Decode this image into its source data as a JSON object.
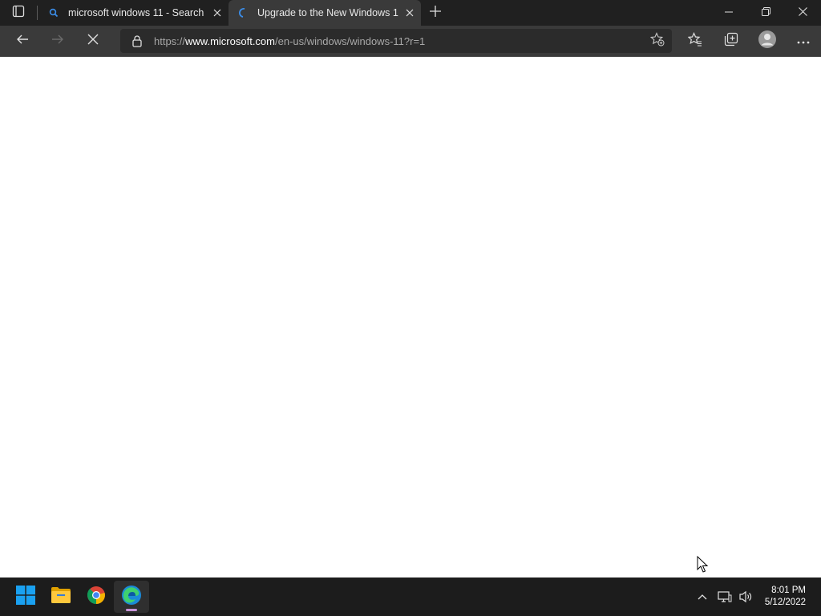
{
  "tabs": [
    {
      "title": "microsoft windows 11 - Search",
      "favicon": "search-icon",
      "active": false
    },
    {
      "title": "Upgrade to the New Windows 1",
      "favicon": "loading-spinner-icon",
      "active": true
    }
  ],
  "toolbar": {
    "url_scheme": "https://",
    "url_host": "www.microsoft.com",
    "url_path": "/en-us/windows/windows-11?r=1"
  },
  "taskbar": {
    "apps": [
      "start-icon",
      "file-explorer-icon",
      "chrome-icon",
      "edge-icon"
    ],
    "time": "8:01 PM",
    "date": "5/12/2022"
  },
  "colors": {
    "titlebar": "#202020",
    "toolbar": "#3a3a3a",
    "addressbar": "#2b2b2b",
    "taskbar": "#1c1c1c",
    "accent": "#0078d4"
  }
}
